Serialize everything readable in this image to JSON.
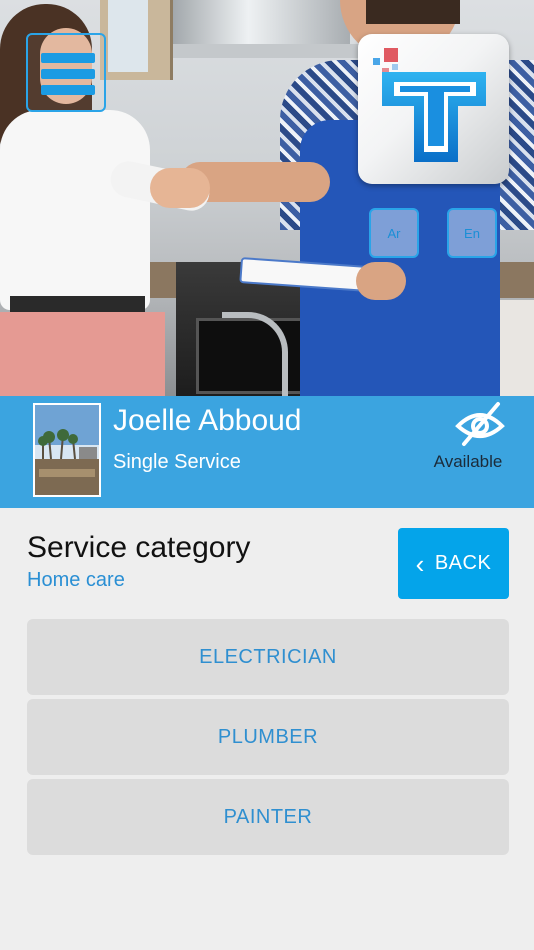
{
  "header": {
    "menu_icon": "hamburger-menu-icon",
    "logo_icon": "t-letter-logo-icon",
    "language_buttons": [
      {
        "label": "Ar"
      },
      {
        "label": "En"
      }
    ]
  },
  "profile": {
    "name": "Joelle Abboud",
    "service_type": "Single Service",
    "status_icon": "eye-slash-icon",
    "status_text": "Available"
  },
  "content": {
    "title": "Service category",
    "subtitle": "Home care",
    "back_icon": "chevron-left-icon",
    "back_label": "BACK",
    "services": [
      {
        "label": "ELECTRICIAN"
      },
      {
        "label": "PLUMBER"
      },
      {
        "label": "PAINTER"
      }
    ]
  },
  "colors": {
    "accent": "#04a4ea",
    "profile_bar": "#3ba4e0",
    "link_text": "#2a8fd4",
    "item_background": "#dcdcdc",
    "page_background": "#eeeeee"
  }
}
